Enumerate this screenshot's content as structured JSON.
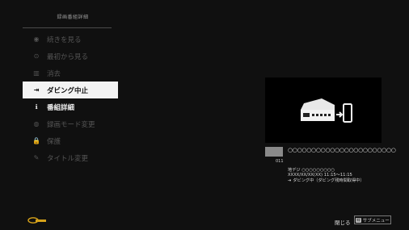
{
  "side_panel": {
    "title": "録画番組詳細",
    "items": [
      {
        "label": "続きを見る",
        "icon": "resume-icon",
        "glyph": "◉",
        "state": "disabled"
      },
      {
        "label": "最初から見る",
        "icon": "play-from-start-icon",
        "glyph": "⊙",
        "state": "disabled"
      },
      {
        "label": "消去",
        "icon": "trash-icon",
        "glyph": "▥",
        "state": "disabled"
      },
      {
        "label": "ダビング中止",
        "icon": "dubbing-icon",
        "glyph": "⇥",
        "state": "selected"
      },
      {
        "label": "番組詳細",
        "icon": "info-icon",
        "glyph": "ℹ",
        "state": "enabled"
      },
      {
        "label": "録画モード変更",
        "icon": "record-mode-icon",
        "glyph": "◍",
        "state": "disabled"
      },
      {
        "label": "保護",
        "icon": "lock-icon",
        "glyph": "🔒",
        "state": "disabled"
      },
      {
        "label": "タイトル変更",
        "icon": "pencil-icon",
        "glyph": "✎",
        "state": "disabled"
      }
    ]
  },
  "program": {
    "channel_number": "011",
    "title": "○○○○○○○○○○○○○○○○○○○○○○○",
    "channel_name": "地デジ ○○○○○○○○○",
    "datetime": "XXXX/XX/XX(XX) 11:15〜11:15",
    "status": "ダビング中（ダビング残時間取得中）"
  },
  "footer": {
    "close_label": "閉じる",
    "sub_menu_key": "緑",
    "sub_menu_label": "サブメニュー"
  },
  "colors": {
    "background": "#101010",
    "selected_bg": "#f3f3f3",
    "logo": "#d6a21a"
  }
}
